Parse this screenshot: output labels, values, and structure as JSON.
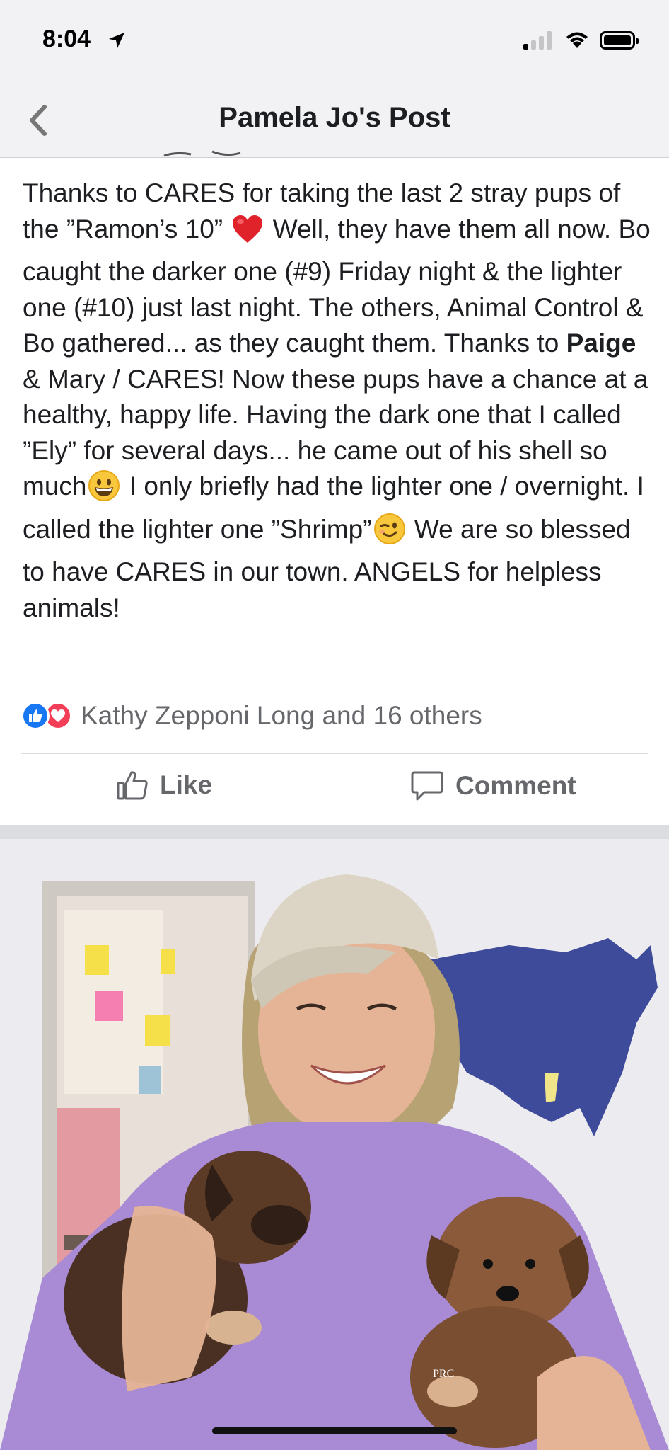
{
  "status_bar": {
    "time": "8:04"
  },
  "nav": {
    "title": "Pamela Jo's Post"
  },
  "post": {
    "text_segments": [
      "Thanks to CARES for taking the last 2 stray pups of the ”Ramon’s 10”",
      "Well, they have them all now. Bo caught the darker one (#9) Friday night & the lighter one (#10) just last night. The others, Animal Control & Bo gathered... as they caught them. Thanks to",
      "Paige",
      "& Mary / CARES! Now these pups have a chance at a healthy, happy life. Having the dark one that I called ”Ely” for several days... he came out of his shell so much",
      "I only briefly had the lighter one / overnight. I called the lighter one ”Shrimp”",
      "We are so blessed to have CARES in our town. ANGELS for helpless animals!"
    ],
    "emojis": [
      "red-heart-emoji",
      "grinning-face-emoji",
      "winking-face-emoji"
    ],
    "reactions_text": "Kathy Zepponi Long and 16 others",
    "like_label": "Like",
    "comment_label": "Comment"
  },
  "photo": {
    "description_icon": "photo-woman-with-two-puppies",
    "shirt_text": "PRC"
  },
  "colors": {
    "like_blue": "#1877f2",
    "love_red": "#f33e58",
    "secondary_text": "#65676b",
    "nav_background": "#f2f2f4"
  }
}
